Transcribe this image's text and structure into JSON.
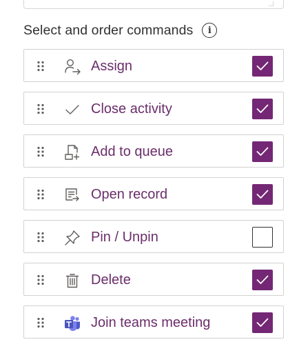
{
  "section": {
    "title": "Select and order commands",
    "info_icon": "info-icon"
  },
  "colors": {
    "accent": "#742774",
    "label": "#6b2d6b"
  },
  "commands": [
    {
      "label": "Assign",
      "icon": "person-arrow-icon",
      "checked": true
    },
    {
      "label": "Close activity",
      "icon": "checkmark-icon",
      "checked": true
    },
    {
      "label": "Add to queue",
      "icon": "queue-add-icon",
      "checked": true
    },
    {
      "label": "Open record",
      "icon": "open-record-icon",
      "checked": true
    },
    {
      "label": "Pin / Unpin",
      "icon": "pin-icon",
      "checked": false
    },
    {
      "label": "Delete",
      "icon": "trash-icon",
      "checked": true
    },
    {
      "label": "Join teams meeting",
      "icon": "teams-icon",
      "checked": true
    }
  ]
}
